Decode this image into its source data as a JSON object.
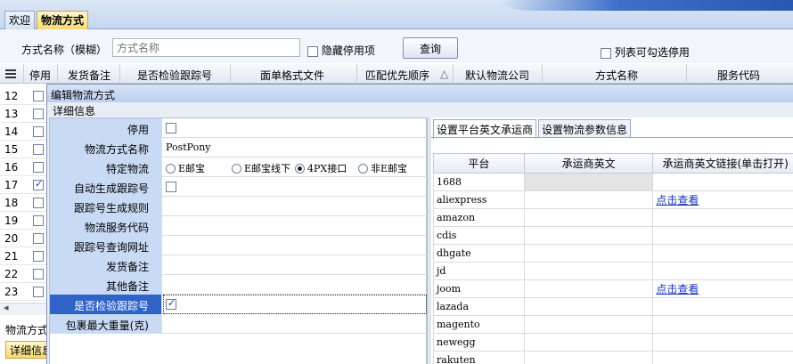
{
  "tabs": {
    "welcome": "欢迎",
    "logistics": "物流方式"
  },
  "search": {
    "label": "方式名称（模糊）",
    "placeholder": "方式名称",
    "hide_disabled": "隐藏停用项",
    "query_button": "查询",
    "list_checkable": "列表可勾选停用"
  },
  "grid": {
    "columns": [
      "停用",
      "发货备注",
      "是否检验跟踪号",
      "面单格式文件",
      "匹配优先顺序",
      "默认物流公司",
      "方式名称",
      "服务代码"
    ],
    "sort_indicator": "△",
    "rows": [
      {
        "num": "12",
        "checked": false
      },
      {
        "num": "13",
        "checked": false
      },
      {
        "num": "14",
        "checked": false
      },
      {
        "num": "15",
        "checked": false
      },
      {
        "num": "16",
        "checked": false
      },
      {
        "num": "17",
        "checked": true
      },
      {
        "num": "18",
        "checked": false
      },
      {
        "num": "19",
        "checked": false
      },
      {
        "num": "20",
        "checked": false
      },
      {
        "num": "21",
        "checked": false
      },
      {
        "num": "22",
        "checked": false
      },
      {
        "num": "23",
        "checked": false
      }
    ]
  },
  "bottom": {
    "label": "物流方式",
    "tab": "详细信息"
  },
  "dialog": {
    "title": "编辑物流方式",
    "subtitle": "详细信息",
    "fields": {
      "disabled": "停用",
      "method_name": "物流方式名称",
      "method_name_value": "PostPony",
      "special": "特定物流",
      "radio_options": [
        "E邮宝",
        "E邮宝线下",
        "4PX接口",
        "非E邮宝"
      ],
      "radio_selected": "4PX接口",
      "auto_tracking": "自动生成跟踪号",
      "tracking_rule": "跟踪号生成规则",
      "service_code": "物流服务代码",
      "tracking_url": "跟踪号查询网址",
      "ship_note": "发货备注",
      "other_note": "其他备注",
      "verify_tracking": "是否检验跟踪号",
      "max_weight": "包裹最大重量(克)"
    },
    "right": {
      "tab_carrier": "设置平台英文承运商",
      "tab_params": "设置物流参数信息",
      "headers": [
        "平台",
        "承运商英文",
        "承运商英文链接(单击打开)"
      ],
      "link_text": "点击查看",
      "rows": [
        {
          "platform": "1688",
          "link": ""
        },
        {
          "platform": "aliexpress",
          "link": "点击查看"
        },
        {
          "platform": "amazon",
          "link": ""
        },
        {
          "platform": "cdis",
          "link": ""
        },
        {
          "platform": "dhgate",
          "link": ""
        },
        {
          "platform": "jd",
          "link": ""
        },
        {
          "platform": "joom",
          "link": "点击查看"
        },
        {
          "platform": "lazada",
          "link": ""
        },
        {
          "platform": "magento",
          "link": ""
        },
        {
          "platform": "newegg",
          "link": ""
        },
        {
          "platform": "rakuten",
          "link": ""
        }
      ]
    }
  }
}
